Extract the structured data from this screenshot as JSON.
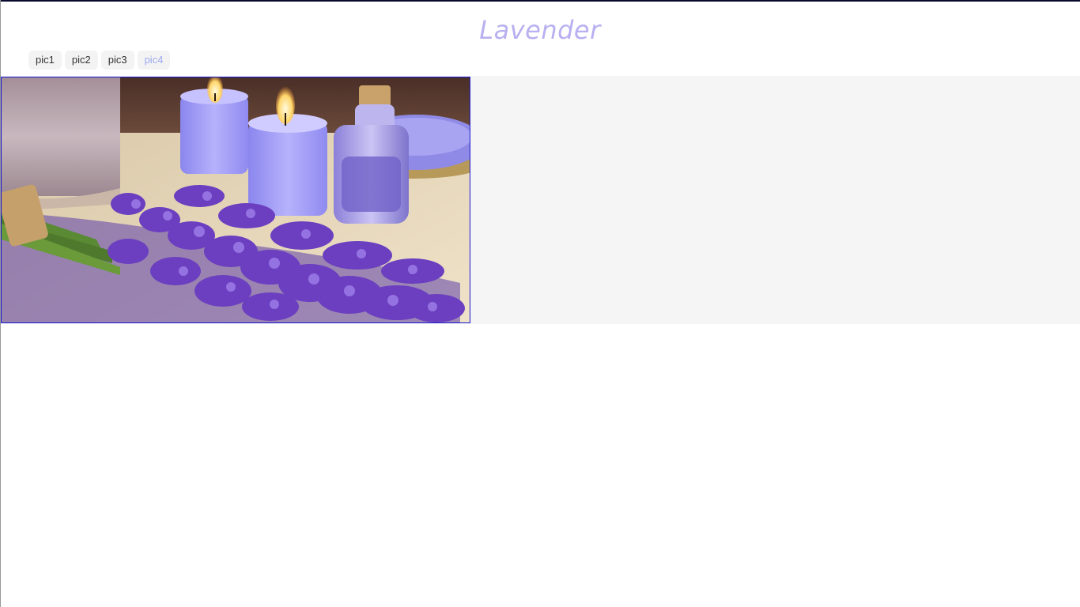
{
  "page": {
    "title": "Lavender"
  },
  "tabs": [
    {
      "label": "pic1",
      "active": false
    },
    {
      "label": "pic2",
      "active": false
    },
    {
      "label": "pic3",
      "active": false
    },
    {
      "label": "pic4",
      "active": true
    }
  ],
  "photo": {
    "subject": "lavender bouquet with lit candles, oil bottle, towel and bath salt"
  },
  "colors": {
    "title": "#b8b0f0",
    "tab_active_text": "#9aa8f0",
    "tab_bg": "#f3f3f3",
    "stage_bg": "#f5f5f5",
    "photo_border": "#1a1ad0"
  }
}
